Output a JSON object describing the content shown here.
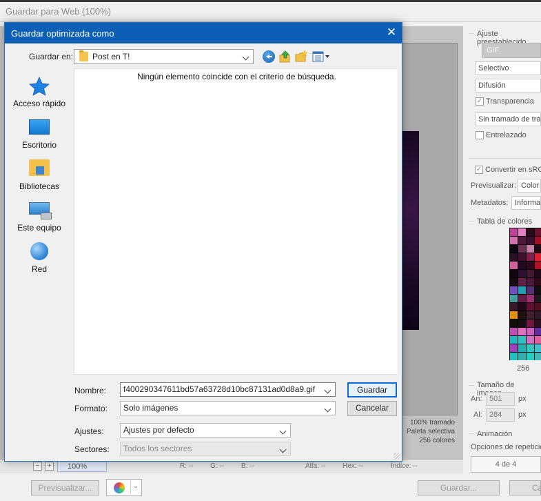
{
  "background_window": {
    "title": "Guardar para Web (100%)",
    "preview_info": [
      "100% tramado",
      "Paleta selectiva",
      "256 colores"
    ],
    "zoom": "100%",
    "zoom_minus": "−",
    "zoom_plus": "+",
    "readouts": {
      "r": "R: --",
      "g": "G: --",
      "b": "B: --",
      "alpha": "Alfa: --",
      "hex": "Hex: --",
      "index": "Índice: --"
    },
    "buttons": {
      "preview": "Previsualizar...",
      "save": "Guardar...",
      "cancel_partial": "Ca"
    }
  },
  "right_panel": {
    "preset_label": "Ajuste preestablecido",
    "format_tab": "GIF",
    "reduction": "Selectivo",
    "dither": "Difusión",
    "transparency_label": "Transparencia",
    "transparency_checked": true,
    "matte_dither": "Sin tramado de transparencia",
    "interlaced_label": "Entrelazado",
    "interlaced_checked": false,
    "convert_srgb_label": "Convertir en sRGB",
    "convert_srgb_checked": true,
    "preview_label": "Previsualizar:",
    "preview_value": "Color de monitor",
    "metadata_label": "Metadatos:",
    "metadata_value": "Información de copyright",
    "color_table_label": "Tabla de colores",
    "color_count": "256",
    "palette": [
      "#c0409a",
      "#e080c0",
      "#2a0a18",
      "#6a1030",
      "#d070b0",
      "#501838",
      "#3a1030",
      "#a01020",
      "#100810",
      "#6a3050",
      "#c080a8",
      "#200a14",
      "#2a1020",
      "#401030",
      "#80204a",
      "#e02030",
      "#d060a0",
      "#200c20",
      "#300a1a",
      "#b01028",
      "#100610",
      "#301030",
      "#401a30",
      "#200a1a",
      "#180818",
      "#602048",
      "#4a1838",
      "#300818",
      "#7050c0",
      "#20a0b0",
      "#503070",
      "#101010",
      "#40a0a0",
      "#6a1a48",
      "#9a3070",
      "#201820",
      "#381828",
      "#200818",
      "#601030",
      "#501020",
      "#e09010",
      "#201010",
      "#402030",
      "#301828",
      "#101008",
      "#181010",
      "#701840",
      "#281020",
      "#c050b0",
      "#e070c0",
      "#d060c0",
      "#6030a0",
      "#20b8c0",
      "#30c0c0",
      "#d070c0",
      "#e060a0",
      "#a040c0",
      "#20b0b0",
      "#30c8c0",
      "#40c0d0",
      "#20c0c0",
      "#30b0b0",
      "#20d0c0",
      "#40b8b8"
    ],
    "image_size_label": "Tamaño de imagen",
    "width_label": "An:",
    "width_value": "501",
    "height_label": "Al:",
    "height_value": "284",
    "unit": "px",
    "animation_label": "Animación",
    "loop_label": "Opciones de repetición",
    "frame_counter": "4 de 4"
  },
  "dialog": {
    "title": "Guardar optimizada como",
    "save_in_label": "Guardar en:",
    "save_in_value": "Post en T!",
    "places": [
      {
        "label": "Acceso rápido"
      },
      {
        "label": "Escritorio"
      },
      {
        "label": "Bibliotecas"
      },
      {
        "label": "Este equipo"
      },
      {
        "label": "Red"
      }
    ],
    "empty_message": "Ningún elemento coincide con el criterio de búsqueda.",
    "name_label": "Nombre:",
    "name_value": "f40029034761 1bd57a63728d10bc87131ad0d8a9.gif",
    "format_label": "Formato:",
    "format_value": "Solo imágenes",
    "settings_label": "Ajustes:",
    "settings_value": "Ajustes por defecto",
    "slices_label": "Sectores:",
    "slices_value": "Todos los sectores",
    "save_button": "Guardar",
    "cancel_button": "Cancelar"
  }
}
